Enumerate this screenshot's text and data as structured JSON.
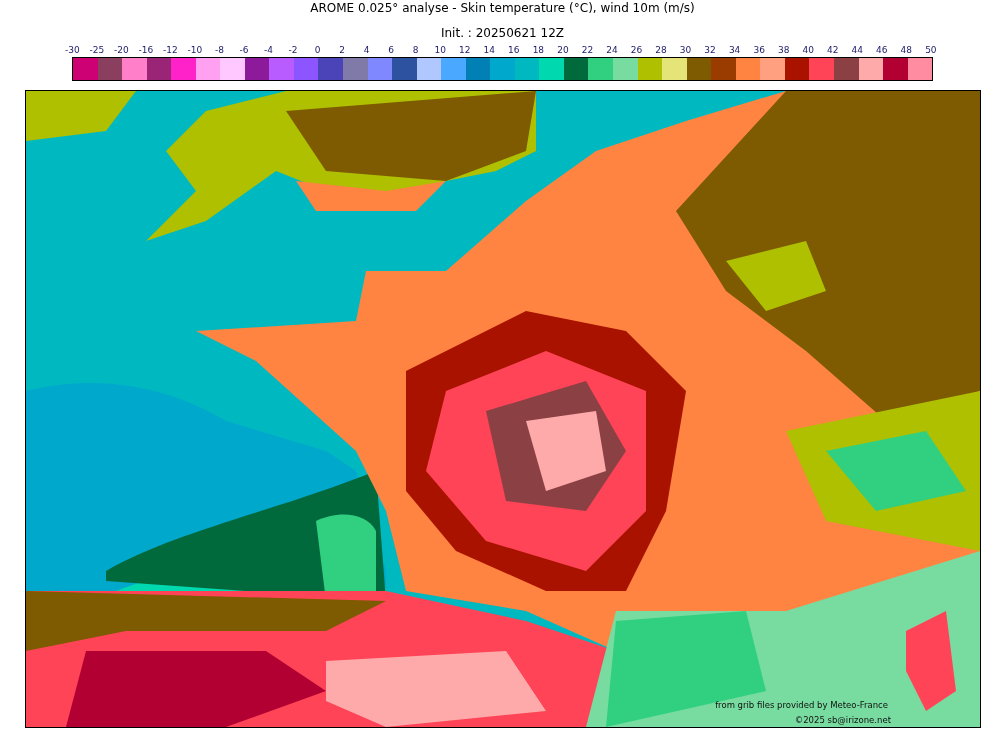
{
  "title": "AROME 0.025° analyse - Skin temperature (°C), wind 10m (m/s)",
  "subtitle": "Init. : 20250621 12Z",
  "colorbar": {
    "ticks": [
      "-30",
      "-25",
      "-20",
      "-16",
      "-12",
      "-10",
      "-8",
      "-6",
      "-4",
      "-2",
      "0",
      "2",
      "4",
      "6",
      "8",
      "10",
      "12",
      "14",
      "16",
      "18",
      "20",
      "22",
      "24",
      "26",
      "28",
      "30",
      "32",
      "34",
      "36",
      "38",
      "40",
      "42",
      "44",
      "46",
      "48",
      "50"
    ],
    "swatches": [
      {
        "color": "#cd0074"
      },
      {
        "color": "#8b3f5f"
      },
      {
        "color": "#ff7fc8"
      },
      {
        "color": "#9a2577"
      },
      {
        "color": "#ff22c8"
      },
      {
        "color": "#ffa0f0"
      },
      {
        "color": "#ffc8ff"
      },
      {
        "color": "#8c1a9a"
      },
      {
        "color": "#b95cff"
      },
      {
        "color": "#8c55ff"
      },
      {
        "color": "#4b44b8"
      },
      {
        "color": "#7f7aa8"
      },
      {
        "color": "#8088ff"
      },
      {
        "color": "#2c52a0"
      },
      {
        "color": "#b0c8ff"
      },
      {
        "color": "#4aa8ff"
      },
      {
        "color": "#0080b4"
      },
      {
        "color": "#00a8cc"
      },
      {
        "color": "#00b8c0"
      },
      {
        "color": "#00d8b0"
      },
      {
        "color": "#006a3c"
      },
      {
        "color": "#30d080"
      },
      {
        "color": "#78dca0"
      },
      {
        "color": "#aec000"
      },
      {
        "color": "#e4e478"
      },
      {
        "color": "#7e5a00"
      },
      {
        "color": "#9a3c00"
      },
      {
        "color": "#ff8442"
      },
      {
        "color": "#ffa080"
      },
      {
        "color": "#aa1200"
      },
      {
        "color": "#ff4458"
      },
      {
        "color": "#8b4044"
      },
      {
        "color": "#ffaaaa"
      },
      {
        "color": "#b30032"
      },
      {
        "color": "#ff8ca0"
      }
    ]
  },
  "credits": [
    "from grib files provided by Meteo-France",
    "©2025 sb@irizone.net"
  ]
}
